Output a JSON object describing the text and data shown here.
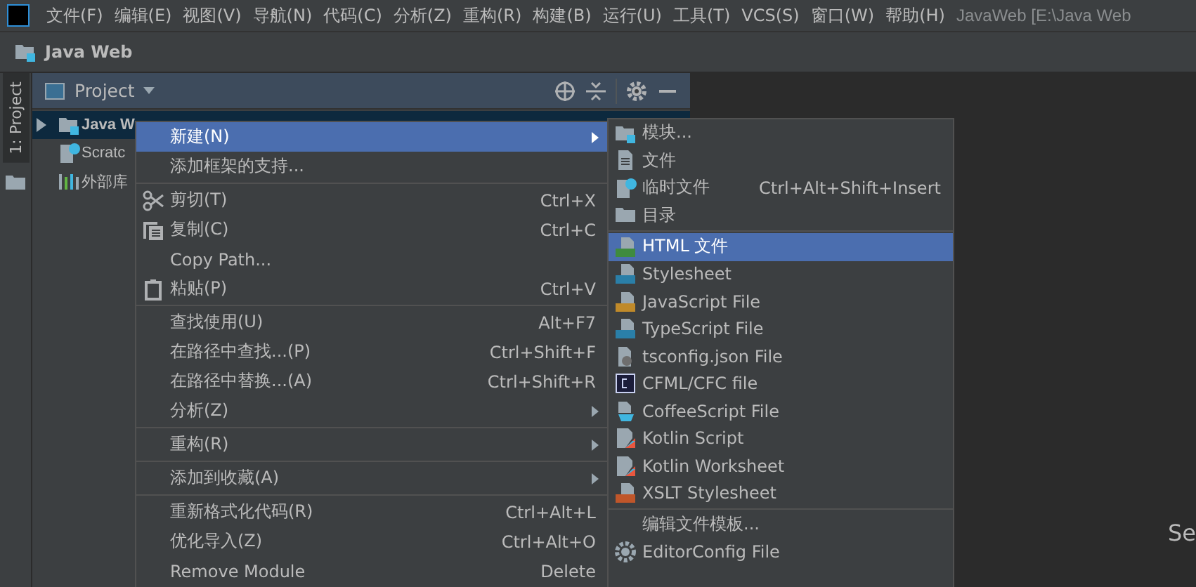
{
  "menubar": {
    "items": [
      "文件(F)",
      "编辑(E)",
      "视图(V)",
      "导航(N)",
      "代码(C)",
      "分析(Z)",
      "重构(R)",
      "构建(B)",
      "运行(U)",
      "工具(T)",
      "VCS(S)",
      "窗口(W)",
      "帮助(H)"
    ],
    "title": "JavaWeb [E:\\Java Web"
  },
  "breadcrumb": "Java Web",
  "side_tabs": [
    {
      "label": "1: Project",
      "selected": true
    }
  ],
  "project_panel": {
    "title": "Project",
    "tree": [
      {
        "label": "Java W",
        "kind": "module",
        "selected": true,
        "expanded": false
      },
      {
        "label": "Scratc",
        "kind": "scratch",
        "selected": false
      },
      {
        "label": "外部库",
        "kind": "library",
        "selected": false
      }
    ]
  },
  "context_menu": [
    {
      "label": "新建(N)",
      "submenu": true,
      "selected": true
    },
    {
      "label": "添加框架的支持...",
      "selected": false
    },
    {
      "label": "剪切(T)",
      "kind": "cut",
      "shortcut": "Ctrl+X",
      "separator_before": true,
      "selected": false
    },
    {
      "label": "复制(C)",
      "kind": "copy",
      "shortcut": "Ctrl+C",
      "selected": false
    },
    {
      "label": "Copy Path...",
      "selected": false
    },
    {
      "label": "粘贴(P)",
      "kind": "paste",
      "shortcut": "Ctrl+V",
      "selected": false
    },
    {
      "label": "查找使用(U)",
      "shortcut": "Alt+F7",
      "separator_before": true,
      "selected": false
    },
    {
      "label": "在路径中查找...(P)",
      "shortcut": "Ctrl+Shift+F",
      "selected": false
    },
    {
      "label": "在路径中替换...(A)",
      "shortcut": "Ctrl+Shift+R",
      "selected": false
    },
    {
      "label": "分析(Z)",
      "submenu": true,
      "selected": false
    },
    {
      "label": "重构(R)",
      "submenu": true,
      "separator_before": true,
      "selected": false
    },
    {
      "label": "添加到收藏(A)",
      "submenu": true,
      "separator_before": true,
      "selected": false
    },
    {
      "label": "重新格式化代码(R)",
      "shortcut": "Ctrl+Alt+L",
      "separator_before": true,
      "selected": false
    },
    {
      "label": "优化导入(Z)",
      "shortcut": "Ctrl+Alt+O",
      "selected": false
    },
    {
      "label": "Remove Module",
      "shortcut": "Delete",
      "selected": false
    }
  ],
  "new_submenu": [
    {
      "label": "模块...",
      "kind": "module",
      "selected": false
    },
    {
      "label": "文件",
      "kind": "file",
      "selected": false
    },
    {
      "label": "临时文件",
      "kind": "scratch",
      "shortcut": "Ctrl+Alt+Shift+Insert",
      "selected": false
    },
    {
      "label": "目录",
      "kind": "folder",
      "selected": false
    },
    {
      "label": "HTML 文件",
      "kind": "html",
      "separator_before": true,
      "selected": true
    },
    {
      "label": "Stylesheet",
      "kind": "css",
      "selected": false
    },
    {
      "label": "JavaScript File",
      "kind": "js",
      "selected": false
    },
    {
      "label": "TypeScript File",
      "kind": "ts",
      "selected": false
    },
    {
      "label": "tsconfig.json File",
      "kind": "json",
      "selected": false
    },
    {
      "label": "CFML/CFC file",
      "kind": "cfml",
      "selected": false
    },
    {
      "label": "CoffeeScript File",
      "kind": "coffee",
      "selected": false
    },
    {
      "label": "Kotlin Script",
      "kind": "kotlin",
      "selected": false
    },
    {
      "label": "Kotlin Worksheet",
      "kind": "kotlin",
      "selected": false
    },
    {
      "label": "XSLT Stylesheet",
      "kind": "xslt",
      "selected": false
    },
    {
      "label": "编辑文件模板...",
      "separator_before": true,
      "selected": false
    },
    {
      "label": "EditorConfig File",
      "kind": "gear",
      "selected": false
    }
  ],
  "editor_hint": "Se"
}
